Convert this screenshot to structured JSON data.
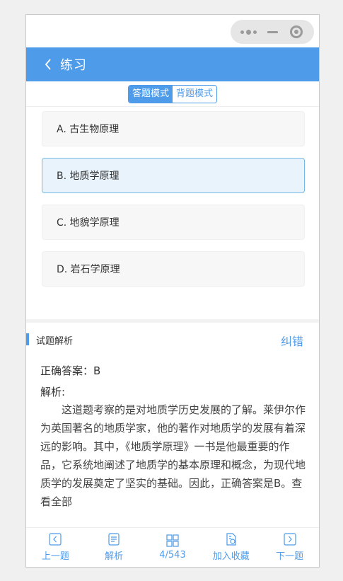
{
  "header": {
    "title": "练习"
  },
  "mode": {
    "answer_mode": "答题模式",
    "recite_mode": "背题模式"
  },
  "options": [
    {
      "label": "A. 古生物原理",
      "selected": false
    },
    {
      "label": "B. 地质学原理",
      "selected": true
    },
    {
      "label": "C. 地貌学原理",
      "selected": false
    },
    {
      "label": "D. 岩石学原理",
      "selected": false
    }
  ],
  "analysis": {
    "title": "试题解析",
    "report": "纠错",
    "answer": "正确答案：B",
    "label": "解析:",
    "text": "这道题考察的是对地质学历史发展的了解。莱伊尔作为英国著名的地质学家，他的著作对地质学的发展有着深远的影响。其中，《地质学原理》一书是他最重要的作品，它系统地阐述了地质学的基本原理和概念，为现代地质学的发展奠定了坚实的基础。因此，正确答案是B。",
    "see_all": "查看全部"
  },
  "bottom_nav": [
    {
      "label": "上一题",
      "icon": "prev-icon"
    },
    {
      "label": "解析",
      "icon": "document-icon"
    },
    {
      "label": "4/543",
      "icon": "grid-icon"
    },
    {
      "label": "加入收藏",
      "icon": "favorite-icon"
    },
    {
      "label": "下一题",
      "icon": "next-icon"
    }
  ],
  "colors": {
    "accent": "#4e9bea",
    "selected_bg": "#e9f3fc"
  }
}
